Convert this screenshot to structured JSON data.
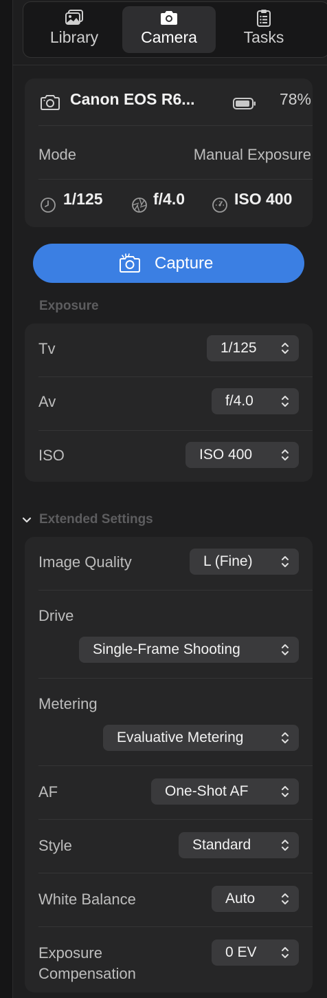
{
  "tabs": [
    {
      "label": "Library",
      "icon": "photo-library-icon",
      "active": false
    },
    {
      "label": "Camera",
      "icon": "camera-icon",
      "active": true
    },
    {
      "label": "Tasks",
      "icon": "clipboard-icon",
      "active": false
    }
  ],
  "device": {
    "name": "Canon EOS R6...",
    "battery": "78%",
    "mode_label": "Mode",
    "mode_value": "Manual Exposure",
    "shutter": "1/125",
    "aperture": "f/4.0",
    "iso": "ISO 400"
  },
  "capture_label": "Capture",
  "exposure": {
    "title": "Exposure",
    "rows": [
      {
        "label": "Tv",
        "value": "1/125"
      },
      {
        "label": "Av",
        "value": "f/4.0"
      },
      {
        "label": "ISO",
        "value": "ISO 400"
      }
    ]
  },
  "extended": {
    "title": "Extended Settings",
    "rows": [
      {
        "label": "Image Quality",
        "value": "L (Fine)"
      },
      {
        "label": "Drive",
        "value": "Single-Frame Shooting"
      },
      {
        "label": "Metering",
        "value": "Evaluative Metering"
      },
      {
        "label": "AF",
        "value": "One-Shot AF"
      },
      {
        "label": "Style",
        "value": "Standard"
      },
      {
        "label": "White Balance",
        "value": "Auto"
      },
      {
        "label": "Exposure Compensation",
        "label_line1": "Exposure",
        "label_line2": "Compensation",
        "value": "0 EV"
      }
    ]
  },
  "colors": {
    "accent": "#3b7fe3",
    "panel": "#1e1e1f",
    "card": "#262627",
    "control": "#3a3a3c"
  }
}
